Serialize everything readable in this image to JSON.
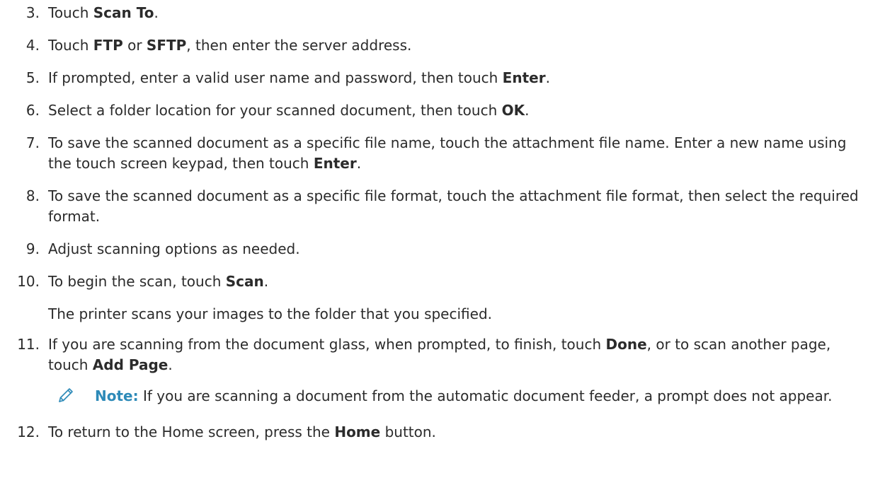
{
  "steps": [
    {
      "n": "3.",
      "pre": "Touch ",
      "b1": "Scan To",
      "mid": "",
      "b2": "",
      "post": "."
    },
    {
      "n": "4.",
      "pre": "Touch ",
      "b1": "FTP",
      "mid": " or ",
      "b2": "SFTP",
      "post": ", then enter the server address."
    },
    {
      "n": "5.",
      "pre": "If prompted, enter a valid user name and password, then touch ",
      "b1": "Enter",
      "mid": "",
      "b2": "",
      "post": "."
    },
    {
      "n": "6.",
      "pre": "Select a folder location for your scanned document, then touch ",
      "b1": "OK",
      "mid": "",
      "b2": "",
      "post": "."
    },
    {
      "n": "7.",
      "pre": "To save the scanned document as a specific file name, touch the attachment file name. Enter a new name using the touch screen keypad, then touch ",
      "b1": "Enter",
      "mid": "",
      "b2": "",
      "post": "."
    },
    {
      "n": "8.",
      "pre": "To save the scanned document as a specific file format, touch the attachment file format, then select the required format.",
      "b1": "",
      "mid": "",
      "b2": "",
      "post": ""
    },
    {
      "n": "9.",
      "pre": "Adjust scanning options as needed.",
      "b1": "",
      "mid": "",
      "b2": "",
      "post": ""
    },
    {
      "n": "10.",
      "pre": "To begin the scan, touch ",
      "b1": "Scan",
      "mid": "",
      "b2": "",
      "post": "."
    },
    {
      "n": "11.",
      "pre": "If you are scanning from the document glass, when prompted, to finish, touch ",
      "b1": "Done",
      "mid": ", or to scan another page, touch ",
      "b2": "Add Page",
      "post": "."
    },
    {
      "n": "12.",
      "pre": "To return to the Home screen, press the ",
      "b1": "Home",
      "mid": " button.",
      "b2": "",
      "post": ""
    }
  ],
  "step10_result": "The printer scans your images to the folder that you specified.",
  "note": {
    "label": "Note:",
    "text": " If you are scanning a document from the automatic document feeder, a prompt does not appear.",
    "icon": "pencil-icon",
    "label_color": "#2d8ab8"
  }
}
